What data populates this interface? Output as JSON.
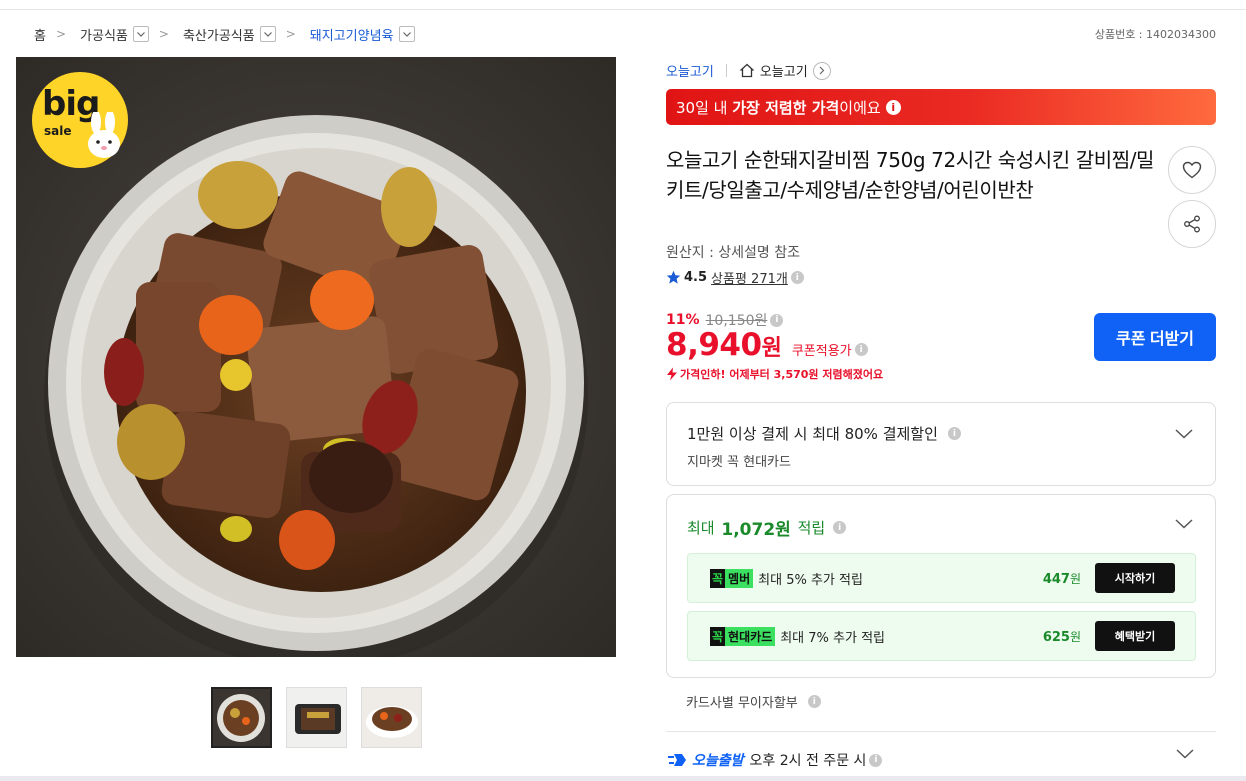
{
  "breadcrumb": {
    "items": [
      {
        "label": "홈"
      },
      {
        "label": "가공식품"
      },
      {
        "label": "축산가공식품"
      },
      {
        "label": "돼지고기양념육"
      }
    ]
  },
  "product_no": "상품번호 : 1402034300",
  "badge": {
    "big": "big",
    "sale": "sale"
  },
  "store": {
    "brand": "오늘고기",
    "shop": "오늘고기"
  },
  "promo": {
    "prefix": "30일 내 ",
    "bold": "가장 저렴한 가격",
    "suffix": "이에요"
  },
  "product": {
    "title": "오늘고기 순한돼지갈비찜 750g 72시간 숙성시킨 갈비찜/밀키트/당일출고/수제양념/순한양념/어린이반찬",
    "origin": "원산지 : 상세설명 참조",
    "rating": "4.5",
    "reviews": "상품평 271개"
  },
  "price": {
    "discount": "11%",
    "original": "10,150원",
    "current": "8,940",
    "unit": "원",
    "coupon_label": "쿠폰적용가",
    "drop_note": "가격인하! 어제부터 3,570원 저렴해졌어요"
  },
  "coupon_button": "쿠폰 더받기",
  "payment": {
    "title": "1만원 이상 결제 시 최대 80% 결제할인",
    "sub": "지마켓 꼭 현대카드"
  },
  "points": {
    "prefix": "최대",
    "amount": "1,072원",
    "suffix": "적립",
    "rows": [
      {
        "tag_k": "꼭",
        "tag_name": "멤버",
        "desc": "최대 5% 추가 적립",
        "pts": "447",
        "unit": "원",
        "button": "시작하기"
      },
      {
        "tag_k": "꼭",
        "tag_name": "현대카드",
        "desc": "최대 7% 추가 적립",
        "pts": "625",
        "unit": "원",
        "button": "혜택받기"
      }
    ]
  },
  "installment": "카드사별 무이자할부",
  "shipping": {
    "brand": "오늘출발",
    "text": "오후 2시 전 주문 시"
  },
  "colors": {
    "accent_blue": "#0f62f5",
    "sale_red": "#e8102a",
    "points_green": "#1a8a2b"
  }
}
